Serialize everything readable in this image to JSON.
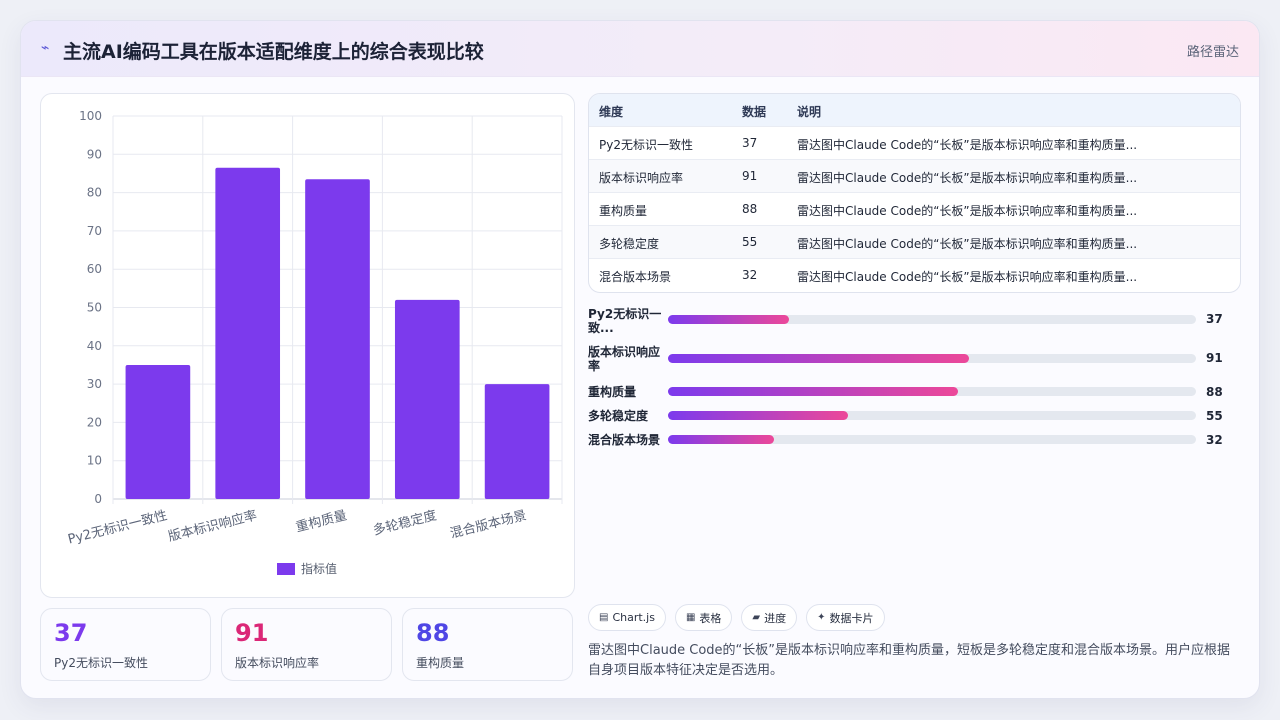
{
  "header": {
    "icon": "lightning-icon",
    "title": "主流AI编码工具在版本适配维度上的综合表现比较",
    "tag": "路径雷达"
  },
  "chart_data": {
    "type": "bar",
    "categories": [
      "Py2无标识一致性",
      "版本标识响应率",
      "重构质量",
      "多轮稳定度",
      "混合版本场景"
    ],
    "series": [
      {
        "name": "指标值",
        "values": [
          35,
          86.5,
          83.5,
          52,
          30
        ],
        "color": "#7c3aed"
      }
    ],
    "ylim": [
      0,
      100
    ],
    "yticks": [
      0,
      10,
      20,
      30,
      40,
      50,
      60,
      70,
      80,
      90,
      100
    ],
    "grid": true,
    "legend": "bottom"
  },
  "stats": [
    {
      "value": "37",
      "label": "Py2无标识一致性",
      "color": "#7c3aed"
    },
    {
      "value": "91",
      "label": "版本标识响应率",
      "color": "#db2777"
    },
    {
      "value": "88",
      "label": "重构质量",
      "color": "#4f46e5"
    }
  ],
  "table": {
    "headers": [
      "维度",
      "数据",
      "说明"
    ],
    "rows": [
      [
        "Py2无标识一致性",
        "37",
        "雷达图中Claude Code的“长板”是版本标识响应率和重构质量..."
      ],
      [
        "版本标识响应率",
        "91",
        "雷达图中Claude Code的“长板”是版本标识响应率和重构质量..."
      ],
      [
        "重构质量",
        "88",
        "雷达图中Claude Code的“长板”是版本标识响应率和重构质量..."
      ],
      [
        "多轮稳定度",
        "55",
        "雷达图中Claude Code的“长板”是版本标识响应率和重构质量..."
      ],
      [
        "混合版本场景",
        "32",
        "雷达图中Claude Code的“长板”是版本标识响应率和重构质量..."
      ]
    ]
  },
  "progress": [
    {
      "label": "Py2无标识一\n致...",
      "value": "37",
      "fill": 0.23
    },
    {
      "label": "版本标识响应\n率",
      "value": "91",
      "fill": 0.57
    },
    {
      "label": "重构质量",
      "value": "88",
      "fill": 0.55
    },
    {
      "label": "多轮稳定度",
      "value": "55",
      "fill": 0.34
    },
    {
      "label": "混合版本场景",
      "value": "32",
      "fill": 0.2
    }
  ],
  "chips": [
    {
      "icon": "chart-icon",
      "glyph": "▤",
      "label": "Chart.js"
    },
    {
      "icon": "table-icon",
      "glyph": "▦",
      "label": "表格"
    },
    {
      "icon": "progress-icon",
      "glyph": "▰",
      "label": "进度"
    },
    {
      "icon": "sparkle-icon",
      "glyph": "✦",
      "label": "数据卡片"
    }
  ],
  "summary": "雷达图中Claude Code的“长板”是版本标识响应率和重构质量，短板是多轮稳定度和混合版本场景。用户应根据自身项目版本特征决定是否选用。"
}
